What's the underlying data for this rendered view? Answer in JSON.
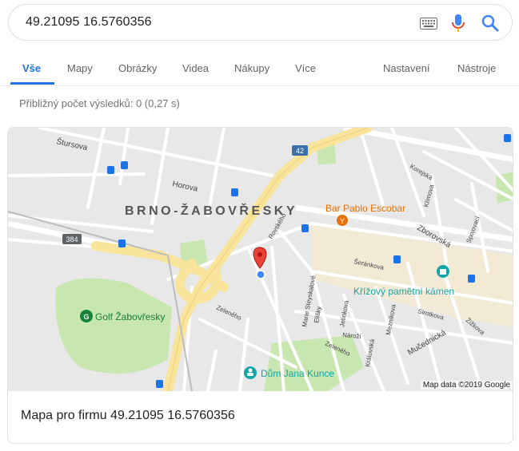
{
  "search": {
    "query": "49.21095 16.5760356"
  },
  "icons": {
    "keyboard": "keyboard-icon",
    "mic": "microphone-icon",
    "search": "search-icon"
  },
  "tabs": [
    {
      "label": "Vše",
      "active": true
    },
    {
      "label": "Mapy"
    },
    {
      "label": "Obrázky"
    },
    {
      "label": "Videa"
    },
    {
      "label": "Nákupy"
    },
    {
      "label": "Více"
    },
    {
      "label": "Nastavení"
    },
    {
      "label": "Nástroje"
    }
  ],
  "stats": "Přibližný počet výsledků: 0 (0,27 s)",
  "map": {
    "district": "BRNO-ŽABOVŘESKY",
    "road_shields": [
      "42",
      "384"
    ],
    "street_labels": [
      "Štursova",
      "Horova",
      "Korejská",
      "Klímova",
      "Zborovská",
      "Spojovací",
      "Šeránkova",
      "Marie Steyskalové",
      "Jelínkova",
      "Elišky",
      "Mezníkova",
      "Sirotkova",
      "Žižkova",
      "Mučednická",
      "Zeleného",
      "Zeleného",
      "Nároží",
      "Královská",
      "Rovského"
    ],
    "places": [
      {
        "name": "Bar Pablo Escobar",
        "color": "#e8710a"
      },
      {
        "name": "Křížový pamětní kámen",
        "color": "#12a6a6"
      },
      {
        "name": "Golf Žabovřesky",
        "color": "#188038"
      },
      {
        "name": "Dům Jana Kunce",
        "color": "#12a6a6"
      }
    ],
    "attribution": "Map data ©2019 Google"
  },
  "card": {
    "title": "Mapa pro firmu 49.21095 16.5760356"
  },
  "colors": {
    "accent": "#1a73e8",
    "major_road": "#f8e49b",
    "park": "#c8e6b0"
  }
}
